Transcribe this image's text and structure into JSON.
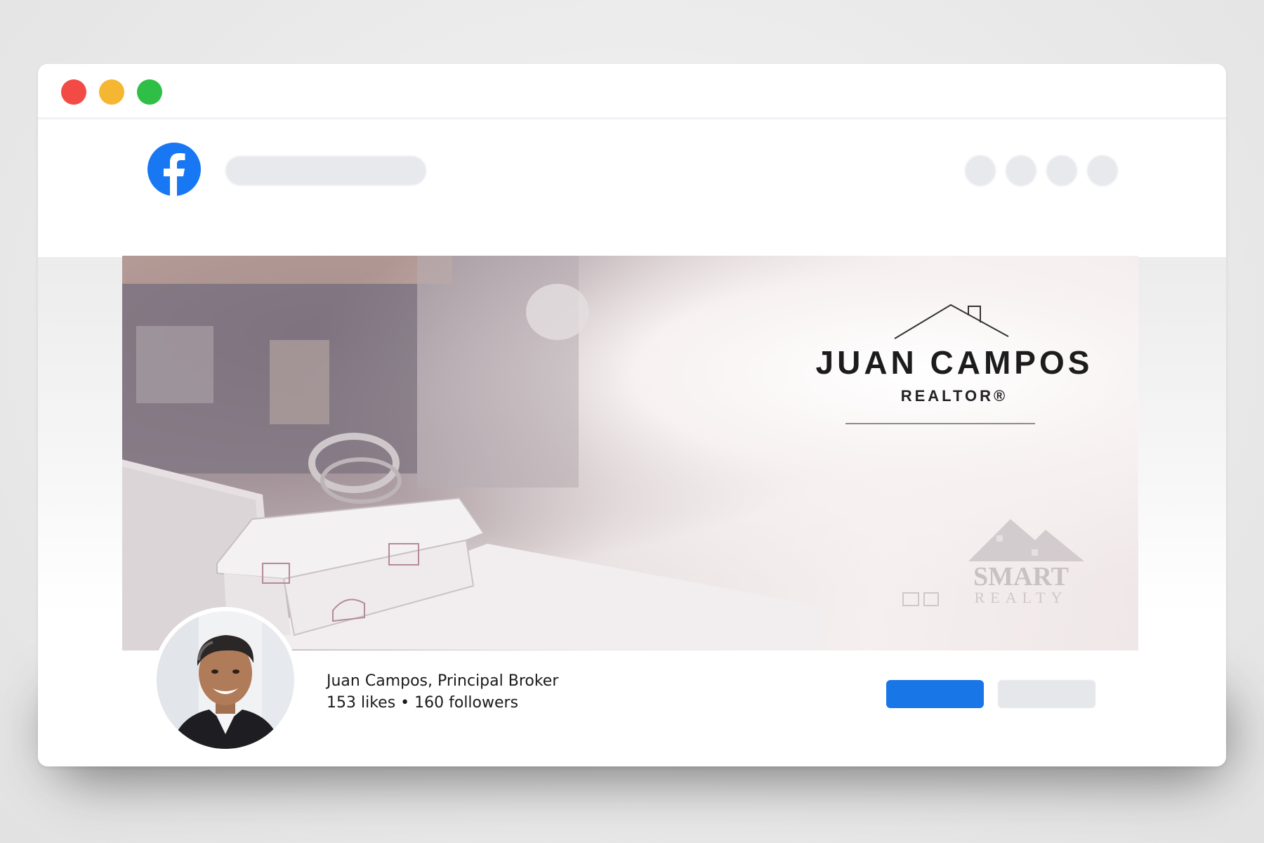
{
  "window": {
    "controls": [
      "close",
      "minimize",
      "maximize"
    ]
  },
  "header": {
    "logo_icon": "facebook-icon",
    "brand_color": "#1877F2"
  },
  "cover": {
    "brand_name": "JUAN CAMPOS",
    "brand_subtitle": "REALTOR®",
    "broker_logo_line1": "SMART",
    "broker_logo_line2": "REALTY"
  },
  "profile": {
    "name_line": "Juan Campos, Principal Broker",
    "stats_line": "153 likes • 160 followers"
  },
  "colors": {
    "primary_button": "#1976E6",
    "secondary_button": "#E5E7EA"
  }
}
